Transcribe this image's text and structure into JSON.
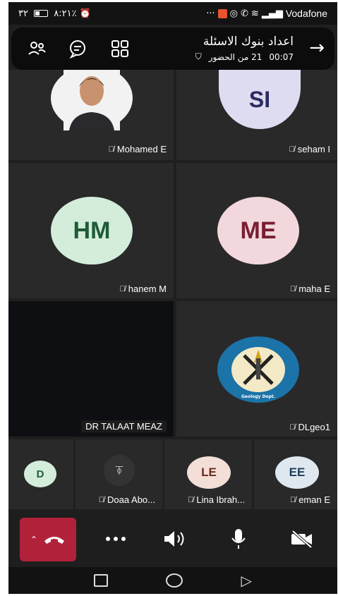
{
  "statusbar": {
    "time": "٨:٢١",
    "battery": "٣٢٪",
    "carrier": "Vodafone"
  },
  "callbar": {
    "title": "اعداد بنوك الاسئلة",
    "attendees": "21 من الحضور",
    "duration": "00:07"
  },
  "participants": [
    {
      "name": "Mohamed E",
      "initials": "",
      "muted": true
    },
    {
      "name": "seham I",
      "initials": "SI",
      "muted": true,
      "bg": "#dedcf0",
      "fg": "#2a2a63"
    },
    {
      "name": "hanem M",
      "initials": "HM",
      "muted": true,
      "bg": "#d4eddb",
      "fg": "#1e5c36"
    },
    {
      "name": "maha E",
      "initials": "ME",
      "muted": true,
      "bg": "#f2d8dc",
      "fg": "#7a1e33"
    },
    {
      "name": "DR TALAAT MEAZ",
      "initials": "",
      "muted": false
    },
    {
      "name": "DLgeo1",
      "initials": "",
      "muted": true
    }
  ],
  "small_participants": [
    {
      "name": "",
      "initials": "D",
      "muted": false,
      "bg": "#d4eddb",
      "fg": "#1e5c36"
    },
    {
      "name": "Doaa Abo...",
      "initials": "",
      "muted": true
    },
    {
      "name": "Lina Ibrah...",
      "initials": "LE",
      "muted": true,
      "bg": "#f3dfd8",
      "fg": "#6a2a1e"
    },
    {
      "name": "eman E",
      "initials": "EE",
      "muted": true,
      "bg": "#dfe8ef",
      "fg": "#1e3c5a"
    }
  ],
  "logo": {
    "text": "Geology Department, Faculty of Science, Tanta University"
  },
  "colors": {
    "hangup": "#b2213a",
    "tile": "#292929",
    "background": "#1f1f1f"
  }
}
